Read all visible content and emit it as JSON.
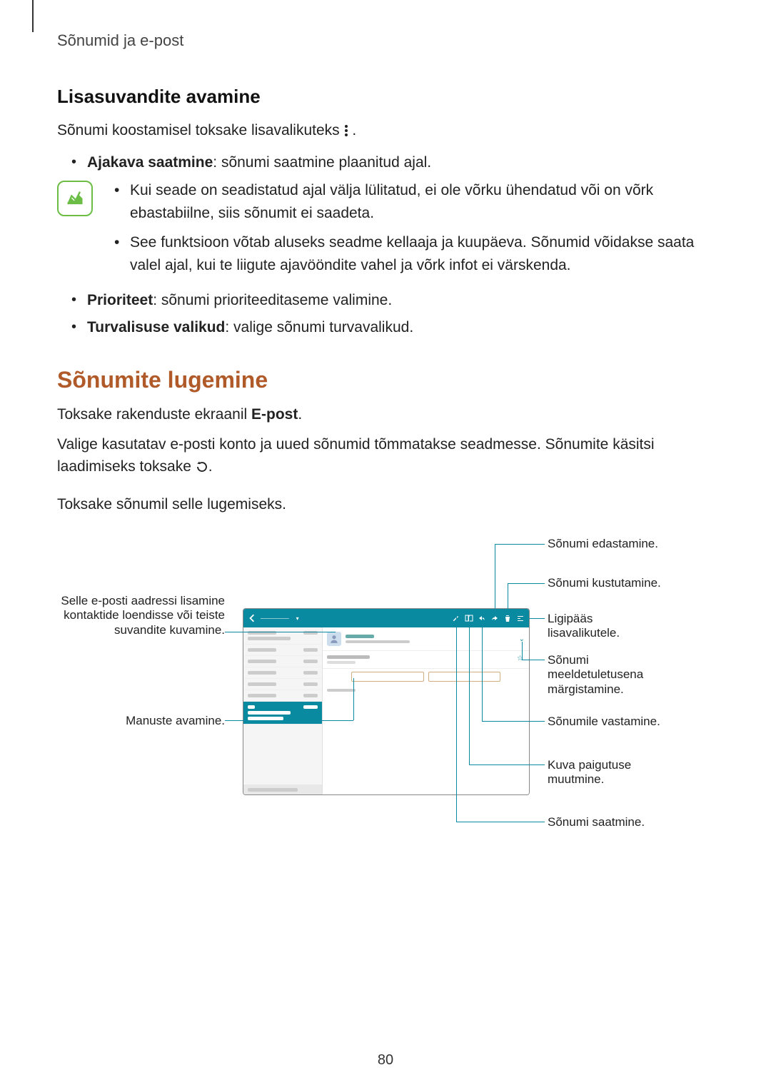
{
  "header": "Sõnumid ja e-post",
  "section1_title": "Lisasuvandite avamine",
  "section1_intro_a": "Sõnumi koostamisel toksake lisavalikuteks ",
  "section1_intro_b": ".",
  "bullet_ajakava_bold": "Ajakava saatmine",
  "bullet_ajakava_rest": ": sõnumi saatmine plaanitud ajal.",
  "note_item1": "Kui seade on seadistatud ajal välja lülitatud, ei ole võrku ühendatud või on võrk ebastabiilne, siis sõnumit ei saadeta.",
  "note_item2": "See funktsioon võtab aluseks seadme kellaaja ja kuupäeva. Sõnumid võidakse saata valel ajal, kui te liigute ajavööndite vahel ja võrk infot ei värskenda.",
  "bullet_prior_bold": "Prioriteet",
  "bullet_prior_rest": ": sõnumi prioriteeditaseme valimine.",
  "bullet_turv_bold": "Turvalisuse valikud",
  "bullet_turv_rest": ": valige sõnumi turvavalikud.",
  "section2_title": "Sõnumite lugemine",
  "reading_p1_a": "Toksake rakenduste ekraanil ",
  "reading_p1_bold": "E-post",
  "reading_p1_b": ".",
  "reading_p2_a": "Valige kasutatav e-posti konto ja uued sõnumid tõmmatakse seadmesse. Sõnumite käsitsi laadimiseks toksake ",
  "reading_p2_b": ".",
  "reading_p3": "Toksake sõnumil selle lugemiseks.",
  "callouts": {
    "left_contact": "Selle e-posti aadressi lisamine kontaktide loendisse või teiste suvandite kuvamine.",
    "left_attach": "Manuste avamine.",
    "r_forward": "Sõnumi edastamine.",
    "r_delete": "Sõnumi kustutamine.",
    "r_more": "Ligipääs lisavalikutele.",
    "r_reminder": "Sõnumi meeldetuletusena märgistamine.",
    "r_reply": "Sõnumile vastamine.",
    "r_layout": "Kuva paigutuse muutmine.",
    "r_send": "Sõnumi saatmine."
  },
  "page_number": "80"
}
